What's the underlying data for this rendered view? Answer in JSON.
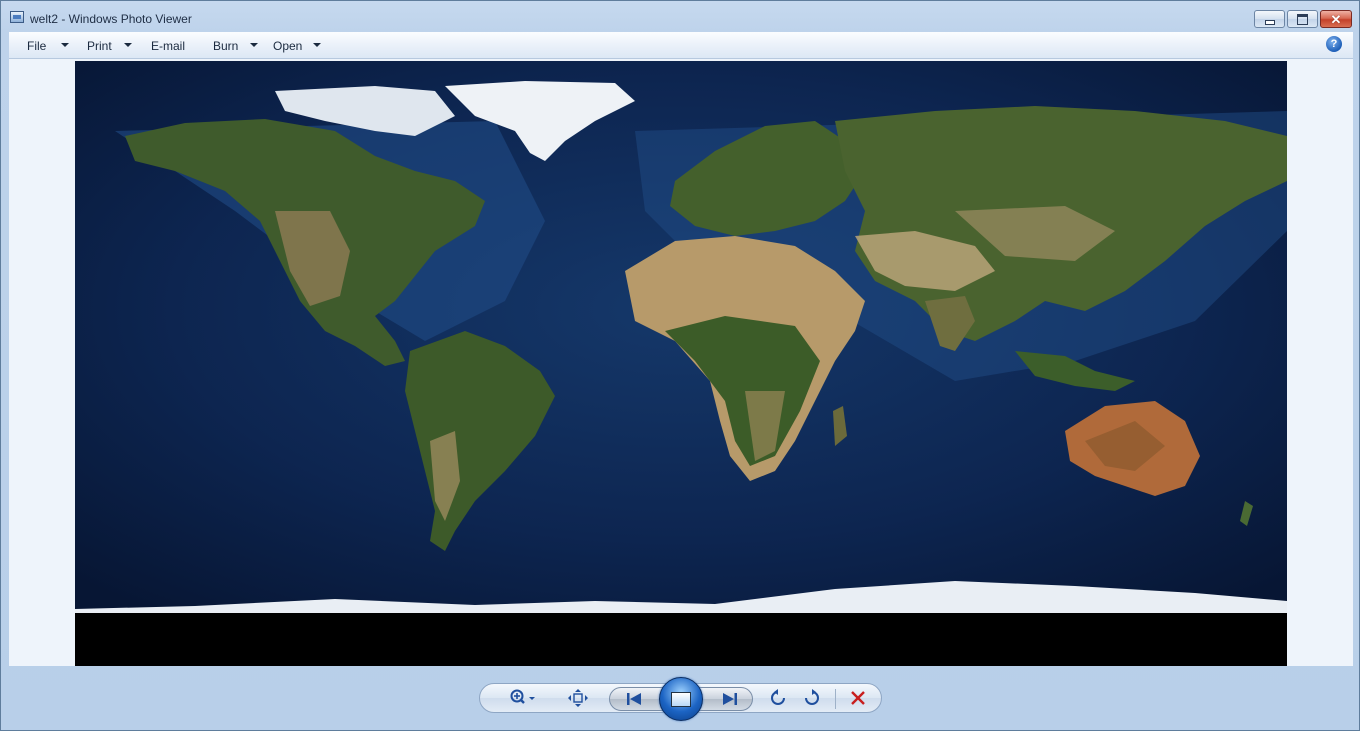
{
  "window": {
    "title": "welt2 - Windows Photo Viewer",
    "icon": "photo-viewer-icon"
  },
  "menu": {
    "items": [
      {
        "label": "File"
      },
      {
        "label": "Print"
      },
      {
        "label": "E-mail"
      },
      {
        "label": "Burn"
      },
      {
        "label": "Open"
      }
    ],
    "help_label": "?"
  },
  "toolbar": {
    "buttons": [
      "zoom-icon",
      "fit-to-window-icon",
      "previous-icon",
      "slideshow-icon",
      "next-icon",
      "rotate-counterclockwise-icon",
      "rotate-clockwise-icon",
      "delete-icon"
    ]
  },
  "colors": {
    "frame": "#b9d1ea",
    "ocean": "#0e2a55",
    "land": "#3b5a2a",
    "desert": "#b79a6a",
    "ice": "#e9eef4",
    "delete": "#c81e1e",
    "accent": "#1c64c4"
  }
}
